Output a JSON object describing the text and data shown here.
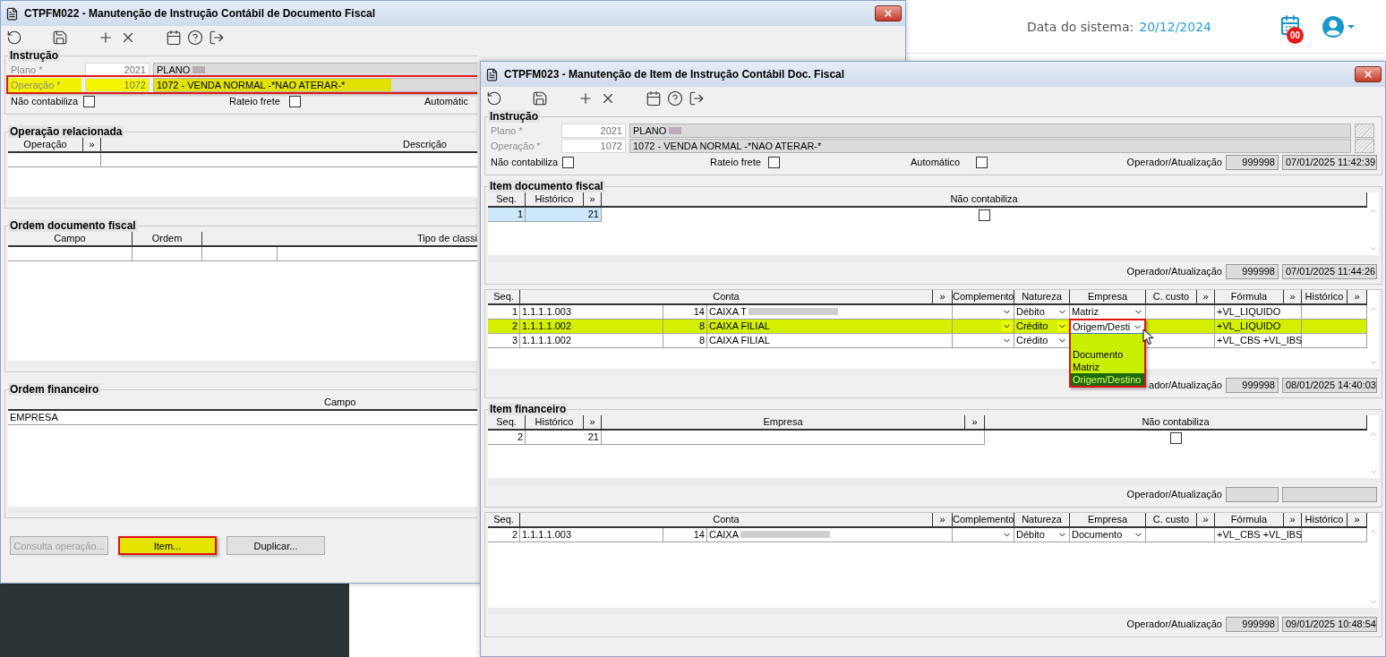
{
  "top_bar": {
    "date_label": "Data do sistema:",
    "date_value": "20/12/2024",
    "notification_count": "00"
  },
  "window_main": {
    "title": "CTPFM022 - Manutenção de Instrução Contábil de Documento Fiscal",
    "instrucao": {
      "legend": "Instrução",
      "fields": [
        {
          "label": "Plano *",
          "code": "2021",
          "description": "PLANO",
          "redacted": true,
          "highlighted": false
        },
        {
          "label": "Operação *",
          "code": "1072",
          "description": "1072 - VENDA NORMAL -*NAO ATERAR-*",
          "redacted": false,
          "highlighted": true
        }
      ],
      "checkboxes": [
        {
          "label": "Não contabiliza",
          "checked": false
        },
        {
          "label": "Rateio frete",
          "checked": false
        }
      ],
      "cut_label": "Automátic"
    },
    "operacao_relacionada": {
      "legend": "Operação relacionada",
      "columns": [
        "Operação",
        "»",
        "Descrição"
      ]
    },
    "ordem_documento_fiscal": {
      "legend": "Ordem documento fiscal",
      "columns": [
        "Campo",
        "Ordem",
        "Tipo de classi"
      ]
    },
    "ordem_financeiro": {
      "legend": "Ordem financeiro",
      "columns": [
        "Campo"
      ],
      "rows": [
        "EMPRESA"
      ]
    },
    "buttons": [
      {
        "label": "Consulta operação...",
        "disabled": true,
        "highlighted": false
      },
      {
        "label": "Item...",
        "disabled": false,
        "highlighted": true
      },
      {
        "label": "Duplicar...",
        "disabled": false,
        "highlighted": false
      }
    ]
  },
  "window_item": {
    "title": "CTPFM023 - Manutenção de Item de Instrução Contábil Doc. Fiscal",
    "instrucao": {
      "legend": "Instrução",
      "fields": [
        {
          "label": "Plano *",
          "code": "2021",
          "description": "PLANO",
          "redacted": true,
          "highlighted": false
        },
        {
          "label": "Operação *",
          "code": "1072",
          "description": "1072 - VENDA NORMAL -*NAO ATERAR-*",
          "redacted": false,
          "highlighted": false
        }
      ],
      "checkboxes": [
        {
          "label": "Não contabiliza",
          "checked": false
        },
        {
          "label": "Rateio frete",
          "checked": false
        },
        {
          "label": "Automático",
          "checked": false
        }
      ],
      "operator_label": "Operador/Atualização",
      "operator": "999998",
      "updated": "07/01/2025 11:42:39"
    },
    "item_documento_fiscal": {
      "legend": "Item documento fiscal",
      "columns": [
        "Seq.",
        "Histórico",
        "»",
        "Não contabiliza"
      ],
      "rows": [
        {
          "seq": "1",
          "historico": "21",
          "nao_contabiliza": false,
          "selected": true
        }
      ],
      "operator_label": "Operador/Atualização",
      "operator": "999998",
      "updated": "07/01/2025 11:44:26"
    },
    "lancamentos": {
      "columns": [
        "Seq.",
        "Conta",
        "»",
        "Complemento",
        "Natureza",
        "Empresa",
        "C. custo",
        "»",
        "Fórmula",
        "»",
        "Histórico",
        "»"
      ],
      "rows": [
        {
          "seq": "1",
          "conta": "1.1.1.1.003",
          "numero": "14",
          "descricao": "CAIXA T",
          "redacted": true,
          "natureza": "Débito",
          "empresa": "Matriz",
          "formula": "+VL_LIQUIDO",
          "selected": false
        },
        {
          "seq": "2",
          "conta": "1.1.1.1.002",
          "numero": "8",
          "descricao": "CAIXA FILIAL",
          "redacted": false,
          "natureza": "Crédito",
          "dropdown": {
            "value": "Origem/Desti",
            "highlighted": true,
            "options": [
              {
                "label": "Documento",
                "selected": false
              },
              {
                "label": "Matriz",
                "selected": false
              },
              {
                "label": "Origem/Destino",
                "selected": true
              }
            ]
          },
          "formula": "+VL_LIQUIDO",
          "selected": true
        },
        {
          "seq": "3",
          "conta": "1.1.1.1.002",
          "numero": "8",
          "descricao": "CAIXA FILIAL",
          "redacted": false,
          "natureza": "Crédito",
          "formula": "+VL_CBS +VL_IBS",
          "selected": false
        }
      ],
      "operator_label": "ador/Atualização",
      "operator": "999998",
      "updated": "08/01/2025 14:40:03"
    },
    "item_financeiro": {
      "legend": "Item financeiro",
      "columns": [
        "Seq.",
        "Histórico",
        "»",
        "Empresa",
        "»",
        "Não contabiliza"
      ],
      "rows": [
        {
          "seq": "2",
          "historico": "21",
          "nao_contabiliza": false,
          "selected": false
        }
      ],
      "operator_label": "Operador/Atualização"
    },
    "lancamentos_financeiro": {
      "columns": [
        "Seq.",
        "Conta",
        "»",
        "Complemento",
        "Natureza",
        "Empresa",
        "C. custo",
        "»",
        "Fórmula",
        "»",
        "Histórico",
        "»"
      ],
      "rows": [
        {
          "seq": "2",
          "conta": "1.1.1.1.003",
          "numero": "14",
          "descricao": "CAIXA",
          "redacted": true,
          "natureza": "Débito",
          "empresa": "Documento",
          "formula": "+VL_CBS +VL_IBS",
          "selected": false
        }
      ],
      "operator_label": "Operador/Atualização",
      "operator": "999998",
      "updated": "09/01/2025 10:48:54"
    }
  }
}
